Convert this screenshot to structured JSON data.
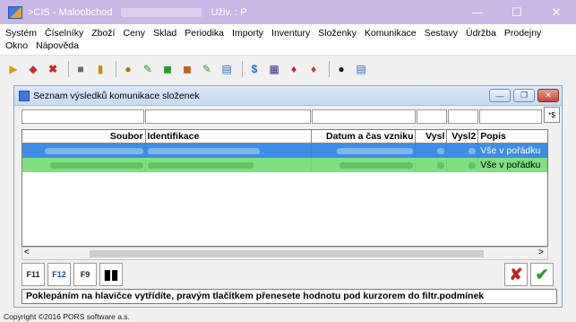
{
  "window": {
    "title": ">CIS - Maloobchod",
    "user_label": "Uživ. : P",
    "minimize": "—",
    "maximize": "☐",
    "close": "✕"
  },
  "menu": {
    "row1": [
      "Systém",
      "Číselníky",
      "Zboží",
      "Ceny",
      "Sklad",
      "Periodika",
      "Importy",
      "Inventury",
      "Složenky",
      "Komunikace",
      "Sestavy",
      "Údržba",
      "Prodejny"
    ],
    "row2": [
      "Okno",
      "Nápověda"
    ]
  },
  "child": {
    "title": "Seznam výsledků komunikace složenek",
    "filter_button": "*$"
  },
  "grid": {
    "headers": [
      "Soubor",
      "Identifikace",
      "Datum a čas vzniku",
      "Vysl",
      "Vysl2",
      "Popis"
    ],
    "rows": [
      {
        "popis": "Vše v pořádku",
        "state": "selected"
      },
      {
        "popis": "Vše v pořádku",
        "state": "ok"
      }
    ]
  },
  "scrollbar": {
    "left": "<",
    "right": ">"
  },
  "bottom_buttons": {
    "f11": "F11",
    "f12": "F12",
    "f9": "F9"
  },
  "status_message": "Poklepáním na hlavičce vytřídíte, pravým tlačítkem přenesete hodnotu pod kurzorem do filtr.podmínek",
  "copyright": "Copyright ©2016 PORS software a.s.",
  "colors": {
    "titlebar": "#c8b8e6",
    "selected_row": "#3e8de6",
    "ok_row": "#7fe07f"
  }
}
